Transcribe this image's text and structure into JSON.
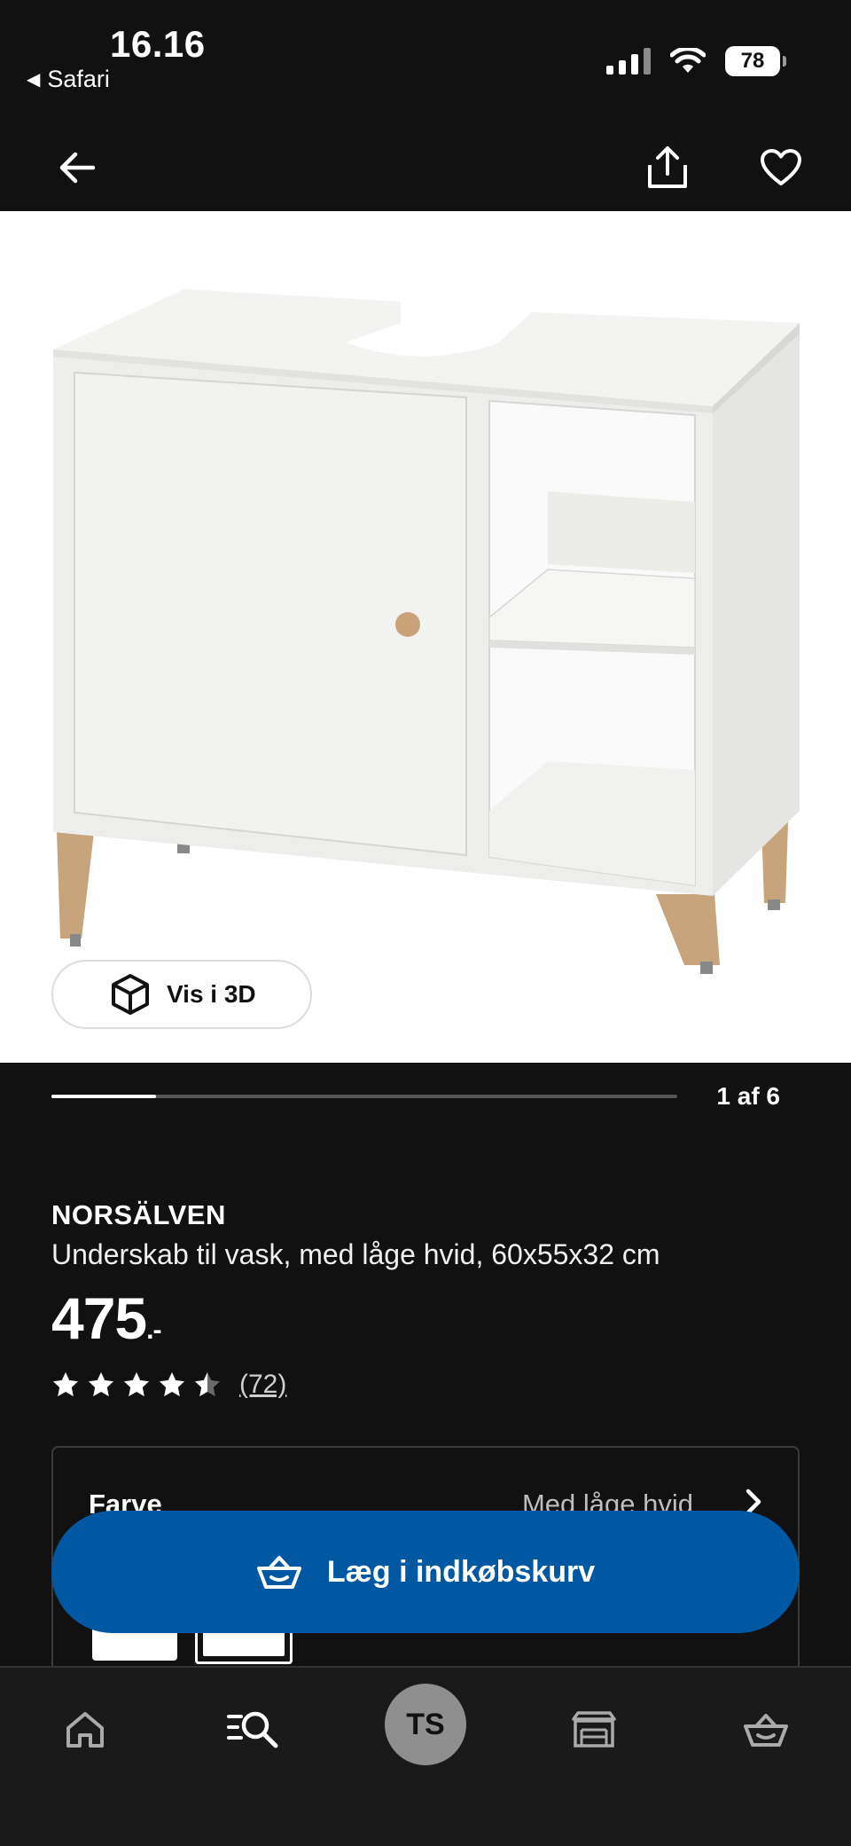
{
  "status_bar": {
    "time": "16.16",
    "back_app": "Safari",
    "battery": "78"
  },
  "header": {
    "back_icon": "arrow-left-icon",
    "share_icon": "share-icon",
    "favorite_icon": "heart-icon"
  },
  "gallery": {
    "view_3d_label": "Vis i 3D",
    "counter": "1 af 6",
    "current_index": 1,
    "total": 6
  },
  "product": {
    "name": "NORSÄLVEN",
    "description": "Underskab til vask, med låge hvid, 60x55x32 cm",
    "price_main": "475",
    "price_suffix": ".-",
    "rating": 4.5,
    "review_count": "(72)"
  },
  "color_selector": {
    "label": "Farve",
    "value": "Med låge hvid"
  },
  "cart_button": {
    "label": "Læg i indkøbskurv",
    "color": "#0058a3"
  },
  "bottom_nav": {
    "avatar_initials": "TS",
    "items": [
      "home-icon",
      "search-icon",
      "avatar",
      "store-icon",
      "basket-icon"
    ]
  }
}
